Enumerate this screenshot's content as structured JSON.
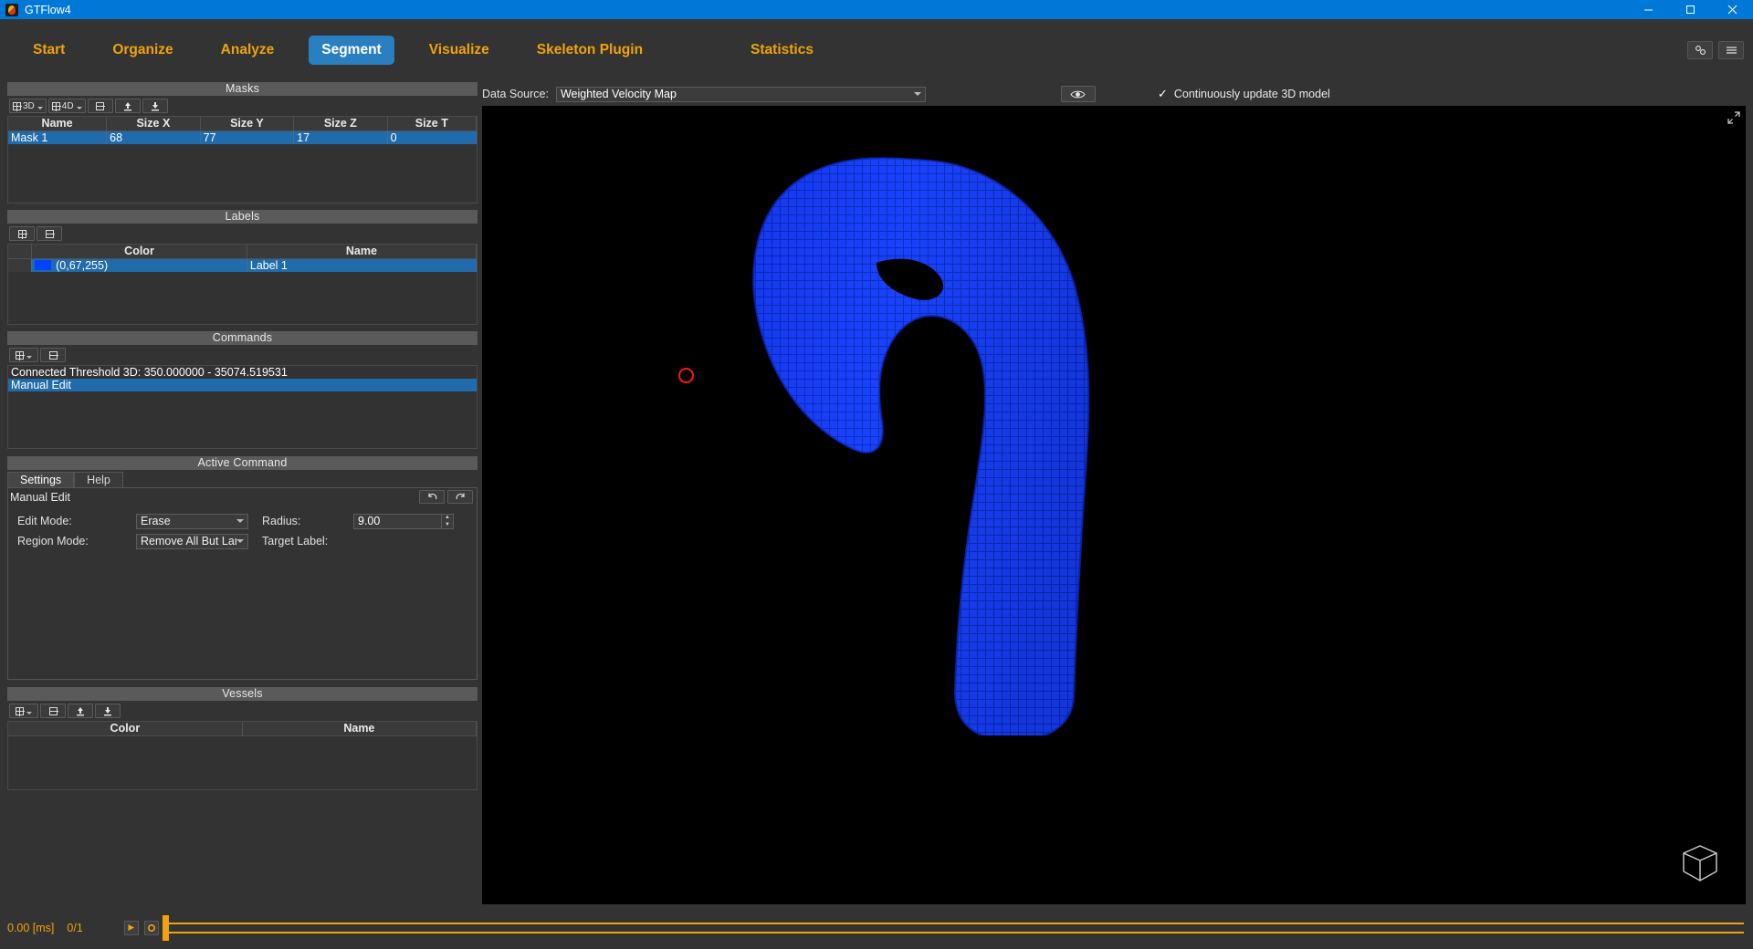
{
  "window": {
    "title": "GTFlow4",
    "logo_icon": "gtflow-logo-icon",
    "minimize_icon": "minimize-icon",
    "maximize_icon": "maximize-icon",
    "close_icon": "close-icon"
  },
  "ribbon": {
    "tabs": [
      {
        "label": "Start",
        "active": false
      },
      {
        "label": "Organize",
        "active": false
      },
      {
        "label": "Analyze",
        "active": false
      },
      {
        "label": "Segment",
        "active": true
      },
      {
        "label": "Visualize",
        "active": false
      },
      {
        "label": "Skeleton Plugin",
        "active": false
      },
      {
        "label": "Statistics",
        "active": false
      }
    ],
    "right_buttons": [
      {
        "name": "settings-gears-icon"
      },
      {
        "name": "hamburger-menu-icon"
      }
    ],
    "accent_color": "#f0a30a",
    "active_tab_color": "#2a7fc1"
  },
  "masks_panel": {
    "title": "Masks",
    "toolbar": [
      {
        "label": "3D",
        "name": "add-3d-mask-button"
      },
      {
        "label": "4D",
        "name": "add-4d-mask-button"
      },
      {
        "label": "",
        "name": "remove-mask-button"
      },
      {
        "label": "",
        "name": "import-mask-button"
      },
      {
        "label": "",
        "name": "export-mask-button"
      }
    ],
    "columns": [
      "Name",
      "Size X",
      "Size Y",
      "Size Z",
      "Size T"
    ],
    "rows": [
      {
        "name": "Mask 1",
        "size_x": "68",
        "size_y": "77",
        "size_z": "17",
        "size_t": "0",
        "selected": true
      }
    ]
  },
  "labels_panel": {
    "title": "Labels",
    "toolbar": [
      {
        "label": "",
        "name": "add-label-button"
      },
      {
        "label": "",
        "name": "remove-label-button"
      }
    ],
    "columns": [
      "Color",
      "Name"
    ],
    "rows": [
      {
        "color_text": "(0,67,255)",
        "color_hex": "#0043ff",
        "name": "Label 1",
        "selected": true
      }
    ]
  },
  "commands_panel": {
    "title": "Commands",
    "toolbar": [
      {
        "label": "",
        "name": "add-command-button"
      },
      {
        "label": "",
        "name": "remove-command-button"
      }
    ],
    "items": [
      {
        "label": "Connected Threshold 3D: 350.000000 - 35074.519531",
        "selected": false
      },
      {
        "label": "Manual Edit",
        "selected": true
      }
    ]
  },
  "active_command_panel": {
    "title": "Active Command",
    "tabs": [
      {
        "label": "Settings",
        "active": true
      },
      {
        "label": "Help",
        "active": false
      }
    ],
    "command_name": "Manual Edit",
    "undo_icon": "undo-icon",
    "redo_icon": "redo-icon",
    "fields": {
      "edit_mode_label": "Edit Mode:",
      "edit_mode_value": "Erase",
      "radius_label": "Radius:",
      "radius_value": "9.00",
      "region_mode_label": "Region Mode:",
      "region_mode_value": "Remove All But Largest",
      "target_label_label": "Target Label:",
      "target_label_value": ""
    }
  },
  "vessels_panel": {
    "title": "Vessels",
    "toolbar": [
      {
        "label": "",
        "name": "add-vessel-button"
      },
      {
        "label": "",
        "name": "remove-vessel-button"
      },
      {
        "label": "",
        "name": "import-vessel-button"
      },
      {
        "label": "",
        "name": "export-vessel-button"
      }
    ],
    "columns": [
      "Color",
      "Name"
    ],
    "rows": []
  },
  "viewer": {
    "data_source_label": "Data Source:",
    "data_source_value": "Weighted Velocity Map",
    "eye_icon": "eye-icon",
    "checkbox_checked": true,
    "checkbox_label": "Continuously update 3D model",
    "expand_icon": "expand-arrows-icon",
    "background_color": "#000000",
    "model_color": "#0a32e8",
    "cursor_icon": "brush-cursor-circle",
    "orientation_cube_icon": "orientation-cube-icon"
  },
  "timeline": {
    "time_value": "0.00 [ms]",
    "frame_value": "0/1",
    "play_icon": "play-icon",
    "settings_icon": "gear-icon",
    "accent_color": "#f0a30a",
    "handle_position_pct": 0
  }
}
